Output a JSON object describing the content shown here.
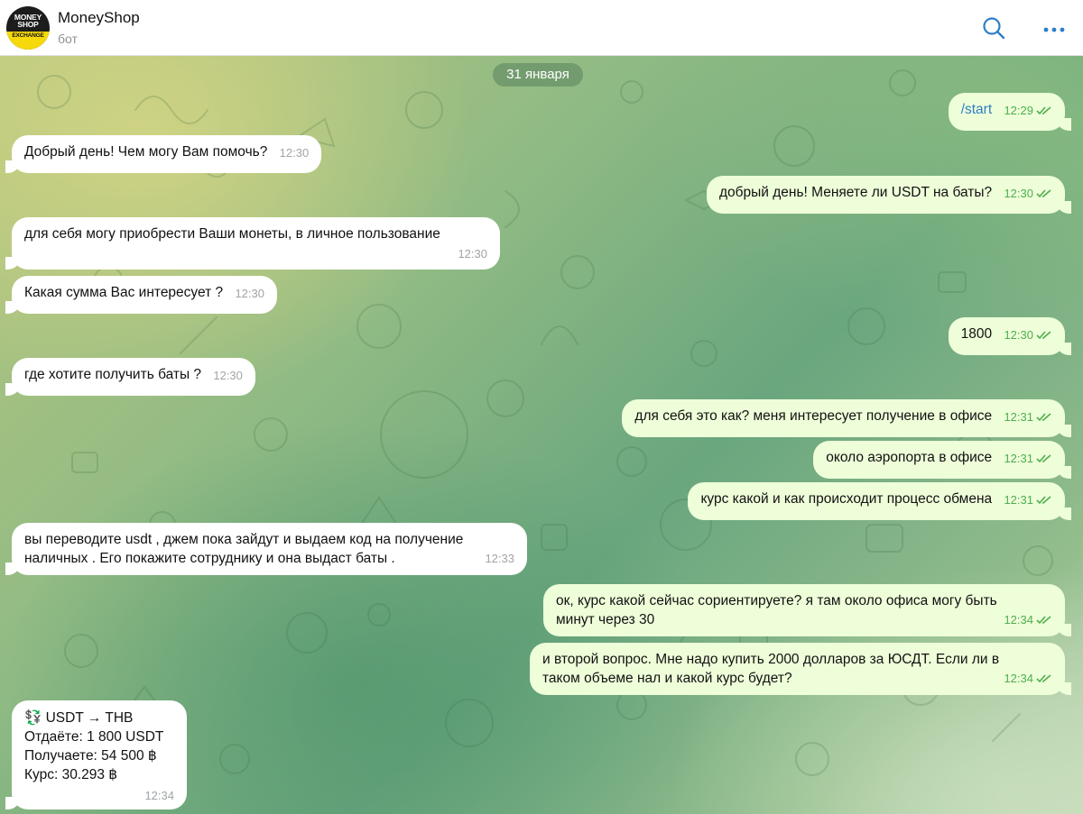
{
  "header": {
    "title": "MoneyShop",
    "subtitle": "бот",
    "avatar_text_top": "MONEY SHOP",
    "avatar_text_bottom": "EXCHANGE"
  },
  "chat": {
    "date_label": "31 января",
    "messages": [
      {
        "dir": "out",
        "text": "/start",
        "time": "12:29",
        "read": true
      },
      {
        "dir": "in",
        "text": "Добрый день! Чем могу Вам помочь?",
        "time": "12:30"
      },
      {
        "dir": "out",
        "text": "добрый день! Меняете ли USDT на баты?",
        "time": "12:30",
        "read": true
      },
      {
        "dir": "in",
        "text": "для себя могу приобрести Ваши монеты, в личное пользование",
        "time": "12:30"
      },
      {
        "dir": "in",
        "text": "Какая сумма Вас интересует ?",
        "time": "12:30"
      },
      {
        "dir": "out",
        "text": "1800",
        "time": "12:30",
        "read": true
      },
      {
        "dir": "in",
        "text": "где хотите получить баты ?",
        "time": "12:30"
      },
      {
        "dir": "out",
        "text": "для себя это как? меня интересует получение в офисе",
        "time": "12:31",
        "read": true
      },
      {
        "dir": "out",
        "text": "около аэропорта в офисе",
        "time": "12:31",
        "read": true
      },
      {
        "dir": "out",
        "text": "курс какой и как происходит процесс обмена",
        "time": "12:31",
        "read": true
      },
      {
        "dir": "in",
        "line1": "вы переводите usdt , джем пока зайдут и выдаем код на получение",
        "line2": "наличных . Его покажите сотруднику и она выдаст баты .",
        "time": "12:33"
      },
      {
        "dir": "out",
        "line1": "ок, курс какой сейчас сориентируете? я там около офиса могу быть",
        "line2": "минут через 30",
        "time": "12:34",
        "read": true
      },
      {
        "dir": "out",
        "line1": "и второй вопрос. Мне надо купить 2000 долларов за ЮСДТ. Если ли в",
        "line2": "таком объеме нал и какой курс будет?",
        "time": "12:34",
        "read": true
      },
      {
        "dir": "in",
        "line1": "💱 USDT → THB",
        "line2": "Отдаёте: 1 800 USDT",
        "line3": "Получаете: 54 500 ฿",
        "line4": "Курс: 30.293 ฿",
        "time": "12:34"
      }
    ]
  },
  "colors": {
    "incoming_bubble": "#ffffff",
    "outgoing_bubble": "#eefed9",
    "time_outgoing": "#4fae4e",
    "accent": "#2e7ec7"
  },
  "icons": {
    "search": "search-icon",
    "more": "more-dots-icon",
    "read_receipt": "double-check-icon"
  }
}
